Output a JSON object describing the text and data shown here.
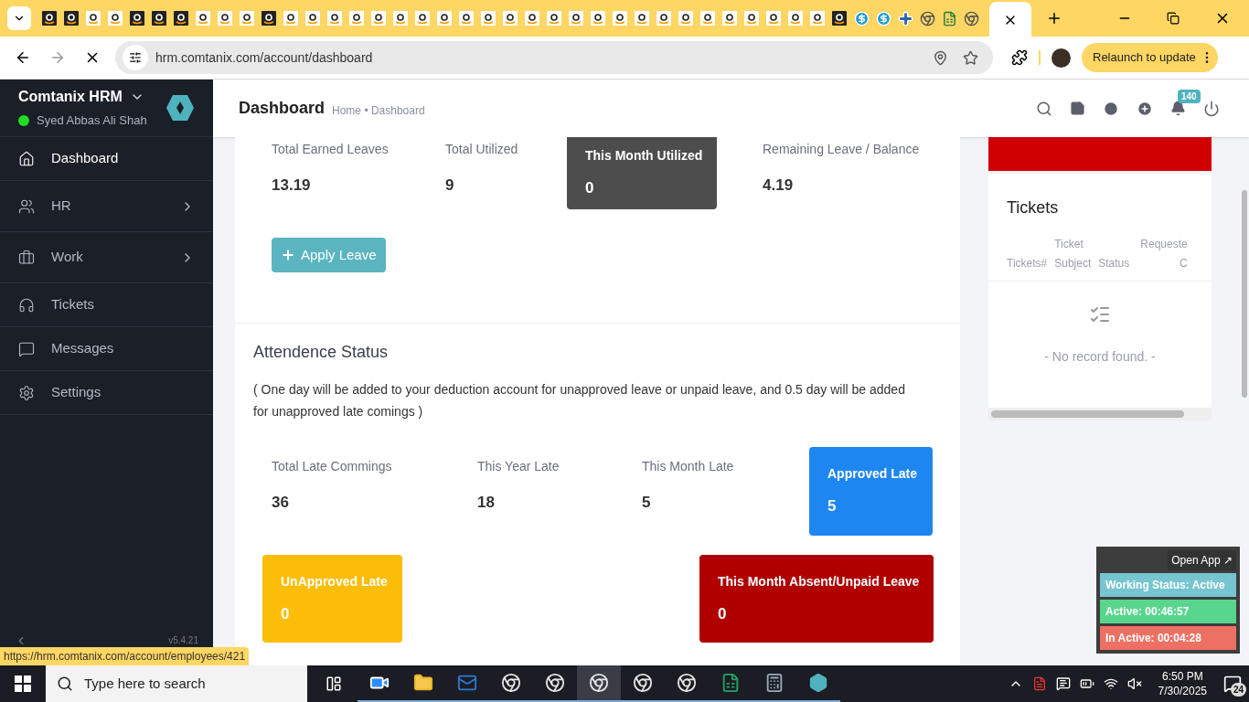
{
  "browser": {
    "tabs": [
      {
        "kind": "amazon-dark",
        "selected": false
      },
      {
        "kind": "amazon-dark",
        "selected": false
      },
      {
        "kind": "amazon",
        "selected": false
      },
      {
        "kind": "amazon",
        "selected": false
      },
      {
        "kind": "amazon-dark",
        "selected": false
      },
      {
        "kind": "amazon-dark",
        "selected": false
      },
      {
        "kind": "amazon-dark",
        "selected": false
      },
      {
        "kind": "amazon",
        "selected": false
      },
      {
        "kind": "amazon",
        "selected": false
      },
      {
        "kind": "amazon",
        "selected": false
      },
      {
        "kind": "amazon-dark",
        "selected": false
      },
      {
        "kind": "amazon",
        "selected": false
      },
      {
        "kind": "amazon",
        "selected": false
      },
      {
        "kind": "amazon",
        "selected": false
      },
      {
        "kind": "amazon",
        "selected": false
      },
      {
        "kind": "amazon",
        "selected": false
      },
      {
        "kind": "amazon",
        "selected": false
      },
      {
        "kind": "amazon",
        "selected": false
      },
      {
        "kind": "amazon",
        "selected": false
      },
      {
        "kind": "amazon",
        "selected": false
      },
      {
        "kind": "amazon",
        "selected": false
      },
      {
        "kind": "amazon",
        "selected": false
      },
      {
        "kind": "amazon",
        "selected": false
      },
      {
        "kind": "amazon",
        "selected": false
      },
      {
        "kind": "amazon",
        "selected": false
      },
      {
        "kind": "amazon",
        "selected": false
      },
      {
        "kind": "amazon",
        "selected": false
      },
      {
        "kind": "amazon",
        "selected": false
      },
      {
        "kind": "amazon",
        "selected": false
      },
      {
        "kind": "amazon",
        "selected": false
      },
      {
        "kind": "amazon",
        "selected": false
      },
      {
        "kind": "amazon",
        "selected": false
      },
      {
        "kind": "amazon",
        "selected": false
      },
      {
        "kind": "amazon",
        "selected": false
      },
      {
        "kind": "amazon",
        "selected": false
      },
      {
        "kind": "amazon",
        "selected": false
      },
      {
        "kind": "amazon-dark",
        "selected": false
      },
      {
        "kind": "dollar",
        "selected": false
      },
      {
        "kind": "dollar",
        "selected": false
      },
      {
        "kind": "cross",
        "selected": false
      },
      {
        "kind": "chrome",
        "selected": false
      },
      {
        "kind": "excel",
        "selected": false
      },
      {
        "kind": "chrome",
        "selected": false
      },
      {
        "selected": true
      }
    ],
    "url": "hrm.comtanix.com/account/dashboard",
    "relaunch": "Relaunch to update",
    "status_link": "https://hrm.comtanix.com/account/employees/421"
  },
  "sidebar": {
    "brand": "Comtanix HRM",
    "user": {
      "name": "Syed Abbas Ali Shah",
      "color": "#22dd22"
    },
    "version": "v5.4.21",
    "items": [
      {
        "label": "Dashboard",
        "kind": "home",
        "expandable": false,
        "selected": true
      },
      {
        "label": "HR",
        "kind": "users",
        "expandable": true,
        "selected": false
      },
      {
        "label": "Work",
        "kind": "briefcase",
        "expandable": true,
        "selected": false
      },
      {
        "label": "Tickets",
        "kind": "headphones",
        "expandable": false,
        "selected": false
      },
      {
        "label": "Messages",
        "kind": "message",
        "expandable": false,
        "selected": false
      },
      {
        "label": "Settings",
        "kind": "settings",
        "expandable": false,
        "selected": false
      }
    ]
  },
  "header": {
    "title": "Dashboard",
    "breadcrumb": "Home • Dashboard",
    "notification_count": "140"
  },
  "leave": {
    "stats": [
      {
        "kind": "plain",
        "label": "Total Earned Leaves",
        "value": "13.19"
      },
      {
        "kind": "plain",
        "label": "Total Utilized",
        "value": "9"
      },
      {
        "kind": "box",
        "label": "This Month Utilized",
        "value": "0",
        "color": "#4d4d4d"
      },
      {
        "kind": "plain",
        "label": "Remaining Leave / Balance",
        "value": "4.19"
      }
    ],
    "apply_button": "Apply Leave"
  },
  "attendance": {
    "title": "Attendence Status",
    "note": "( One day will be added to your deduction account for unapproved leave or unpaid leave, and 0.5 day will be added for unapproved late comings )",
    "row_1": [
      {
        "kind": "plain",
        "label": "Total Late Commings",
        "value": "36"
      },
      {
        "kind": "plain",
        "label": "This Year Late",
        "value": "18"
      },
      {
        "kind": "plain",
        "label": "This Month Late",
        "value": "5"
      },
      {
        "kind": "box",
        "label": "Approved Late",
        "value": "5",
        "color": "#1e86f0"
      }
    ],
    "row_2": [
      {
        "kind": "box",
        "label": "UnApproved Late",
        "value": "0",
        "color": "#fbbd08"
      },
      {
        "kind": "box",
        "label": "This Month Absent/Unpaid Leave",
        "value": "0",
        "color": "#b00000"
      }
    ]
  },
  "tickets": {
    "title": "Tickets",
    "columns": [
      {
        "lines": [
          "Tickets#"
        ]
      },
      {
        "lines": [
          "Ticket",
          "Subject"
        ]
      },
      {
        "lines": [
          "Status"
        ]
      },
      {
        "lines": [
          "Requeste",
          "C"
        ]
      }
    ],
    "empty": "- No record found. -"
  },
  "tracker": {
    "open_app": "Open App ↗",
    "rows": [
      {
        "text": "Working Status: Active",
        "color": "#76c5d0"
      },
      {
        "text": "Active: 00:46:57",
        "color": "#58d68d"
      },
      {
        "text": "In Active: 00:04:28",
        "color": "#ec7063"
      }
    ]
  },
  "taskbar": {
    "search_placeholder": "Type here to search",
    "apps": [
      {
        "kind": "zoom",
        "selected": false
      },
      {
        "kind": "folder",
        "selected": false
      },
      {
        "kind": "outlook",
        "selected": false
      },
      {
        "kind": "chrome",
        "selected": false
      },
      {
        "kind": "chrome",
        "selected": false
      },
      {
        "kind": "chrome",
        "selected": true
      },
      {
        "kind": "chrome",
        "selected": false
      },
      {
        "kind": "chrome",
        "selected": false
      },
      {
        "kind": "excel",
        "selected": false
      },
      {
        "kind": "calculator",
        "selected": false
      },
      {
        "kind": "hex",
        "selected": false
      }
    ],
    "time": "6:50 PM",
    "date": "7/30/2025",
    "notifications": "24"
  }
}
